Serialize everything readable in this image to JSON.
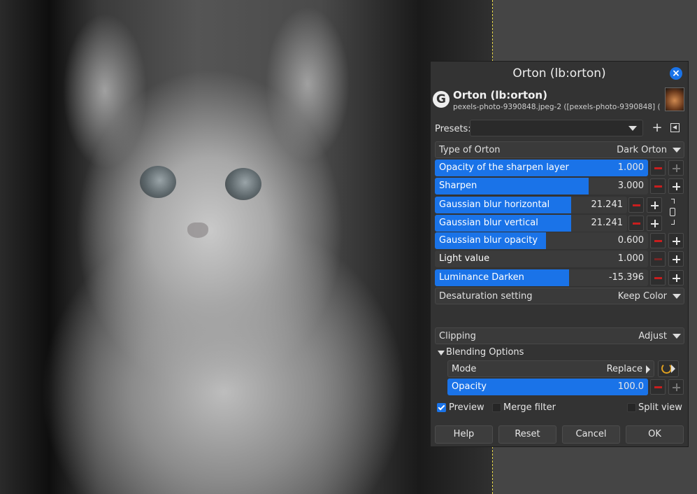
{
  "dialog": {
    "title": "Orton (lb:orton)",
    "header_title": "Orton (lb:orton)",
    "header_subtitle": "pexels-photo-9390848.jpeg-2 ([pexels-photo-9390848] (imp...",
    "presets_label": "Presets:",
    "presets_value": ""
  },
  "type_of_orton": {
    "label": "Type of Orton",
    "value": "Dark Orton"
  },
  "sliders": [
    {
      "label": "Opacity of the sharpen layer",
      "value": "1.000",
      "fill": 1.0
    },
    {
      "label": "Sharpen",
      "value": "3.000",
      "fill": 0.72
    },
    {
      "label": "Gaussian blur horizontal",
      "value": "21.241",
      "fill": 0.71
    },
    {
      "label": "Gaussian blur vertical",
      "value": "21.241",
      "fill": 0.71
    },
    {
      "label": "Gaussian blur opacity",
      "value": "0.600",
      "fill": 0.52
    },
    {
      "label": "Light value",
      "value": "1.000",
      "fill": 0.0
    },
    {
      "label": "Luminance Darken",
      "value": "-15.396",
      "fill": 0.63
    }
  ],
  "desaturation": {
    "label": "Desaturation setting",
    "value": "Keep Color"
  },
  "clipping": {
    "label": "Clipping",
    "value": "Adjust"
  },
  "blending": {
    "label": "Blending Options",
    "mode_label": "Mode",
    "mode_value": "Replace",
    "opacity_label": "Opacity",
    "opacity_value": "100.0",
    "opacity_fill": 1.0
  },
  "checkboxes": {
    "preview": {
      "label": "Preview",
      "checked": true
    },
    "merge": {
      "label": "Merge filter",
      "checked": false
    },
    "split": {
      "label": "Split view",
      "checked": false
    }
  },
  "buttons": {
    "help": "Help",
    "reset": "Reset",
    "cancel": "Cancel",
    "ok": "OK"
  },
  "colors": {
    "accent": "#1a73e8",
    "minus": "#c81e1e",
    "guide": "#e8d84a"
  }
}
